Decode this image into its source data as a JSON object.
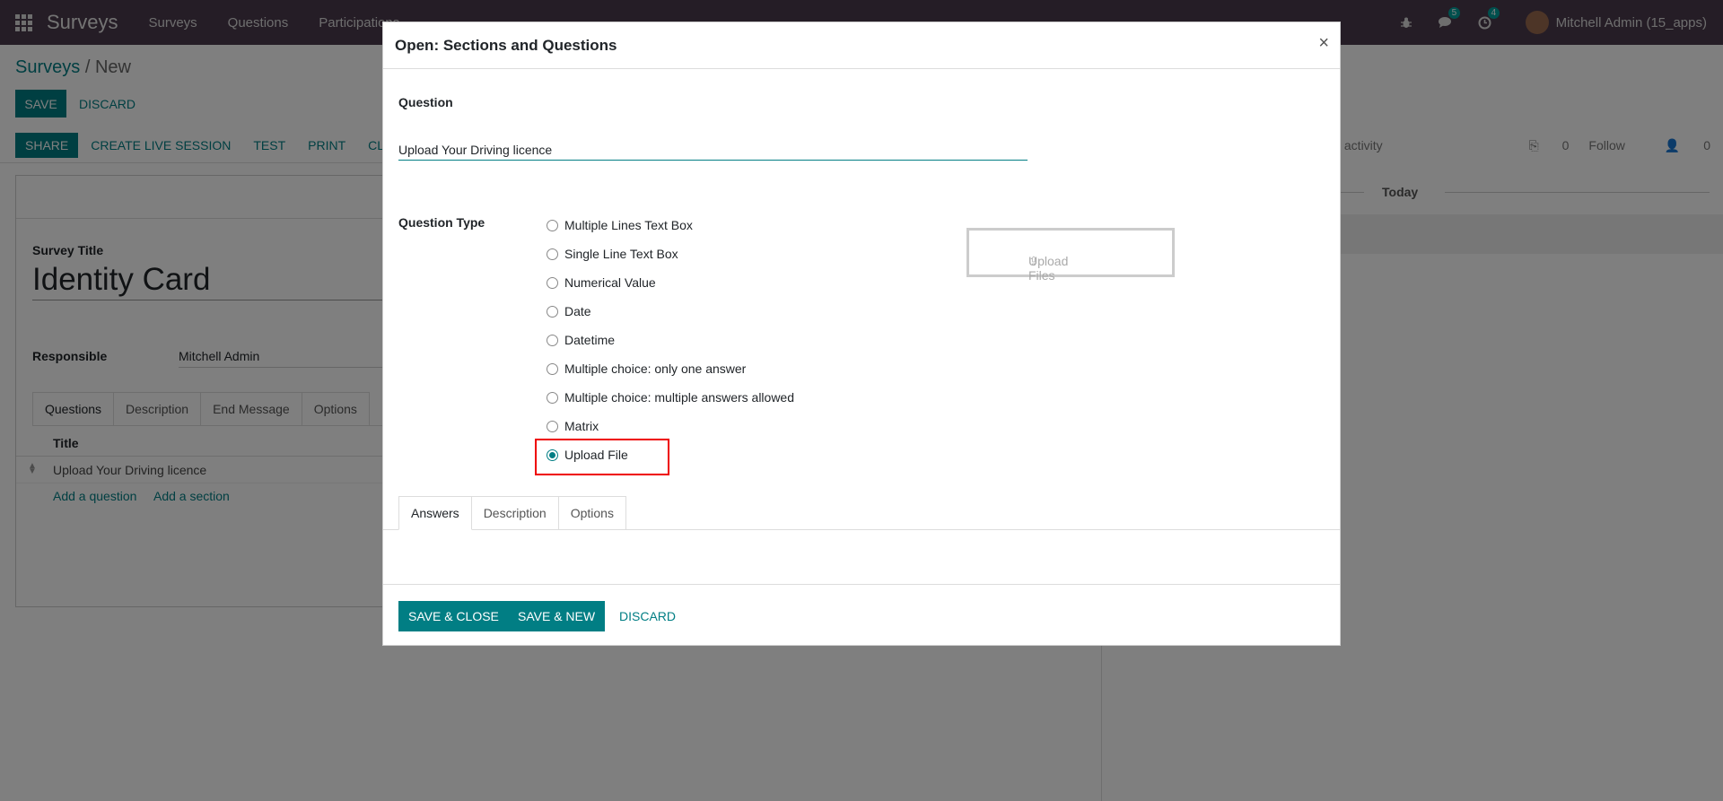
{
  "navbar": {
    "brand": "Surveys",
    "menu": [
      "Surveys",
      "Questions",
      "Participations"
    ],
    "messages_count": "5",
    "activities_count": "4",
    "user": "Mitchell Admin (15_apps)"
  },
  "page": {
    "breadcrumb_root": "Surveys",
    "breadcrumb_sep": "/",
    "breadcrumb_current": "New",
    "save_label": "SAVE",
    "discard_label": "DISCARD",
    "statusbar": [
      "SHARE",
      "CREATE LIVE SESSION",
      "TEST",
      "PRINT",
      "CLOSE"
    ],
    "survey_title_label": "Survey Title",
    "survey_title": "Identity Card",
    "responsible_label": "Responsible",
    "responsible": "Mitchell Admin",
    "tabs": [
      "Questions",
      "Description",
      "End Message",
      "Options"
    ],
    "list_header": "Title",
    "list_row": "Upload Your Driving licence",
    "add_question": "Add a question",
    "add_section": "Add a section"
  },
  "chatter": {
    "schedule_activity": "ile activity",
    "attachments": "0",
    "follow": "Follow",
    "followers": "0",
    "today": "Today"
  },
  "modal": {
    "title": "Open: Sections and Questions",
    "close": "×",
    "question_label": "Question",
    "question_value": "Upload Your Driving licence",
    "question_type_label": "Question Type",
    "question_types": [
      "Multiple Lines Text Box",
      "Single Line Text Box",
      "Numerical Value",
      "Date",
      "Datetime",
      "Multiple choice: only one answer",
      "Multiple choice: multiple answers allowed",
      "Matrix",
      "Upload File"
    ],
    "selected_type": "Upload File",
    "upload_files": "Upload Files",
    "tabs": [
      "Answers",
      "Description",
      "Options"
    ],
    "save_close": "SAVE & CLOSE",
    "save_new": "SAVE & NEW",
    "discard": "DISCARD"
  },
  "colors": {
    "primary": "#017e84",
    "navbar": "#4b3a4d",
    "highlight": "#e00000"
  }
}
